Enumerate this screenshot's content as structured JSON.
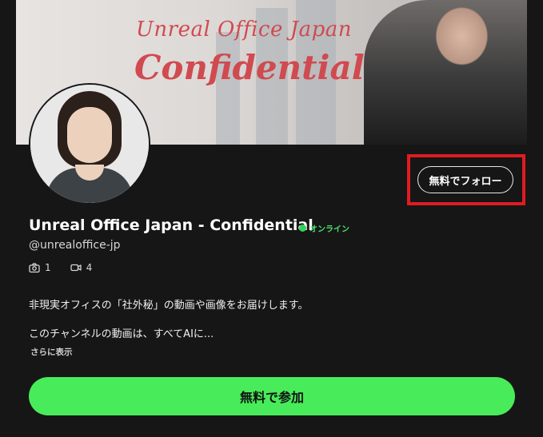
{
  "banner": {
    "title_line1": "Unreal Office Japan",
    "title_line2": "Confidential"
  },
  "profile": {
    "name": "Unreal Office Japan - Confidential",
    "status": "オンライン",
    "handle": "@unrealoffice-jp",
    "photo_count": "1",
    "video_count": "4",
    "description_line1": "非現実オフィスの「社外秘」の動画や画像をお届けします。",
    "description_line2": "このチャンネルの動画は、すべてAIに...",
    "show_more": "さらに表示"
  },
  "actions": {
    "follow_label": "無料でフォロー",
    "join_label": "無料で参加"
  },
  "colors": {
    "background": "#161616",
    "accent_green": "#48ec5a",
    "online_green": "#32d35b",
    "highlight_red": "#e11b22",
    "banner_text": "#d04a4f"
  },
  "icons": {
    "photo": "camera-icon",
    "video": "video-camera-icon"
  }
}
